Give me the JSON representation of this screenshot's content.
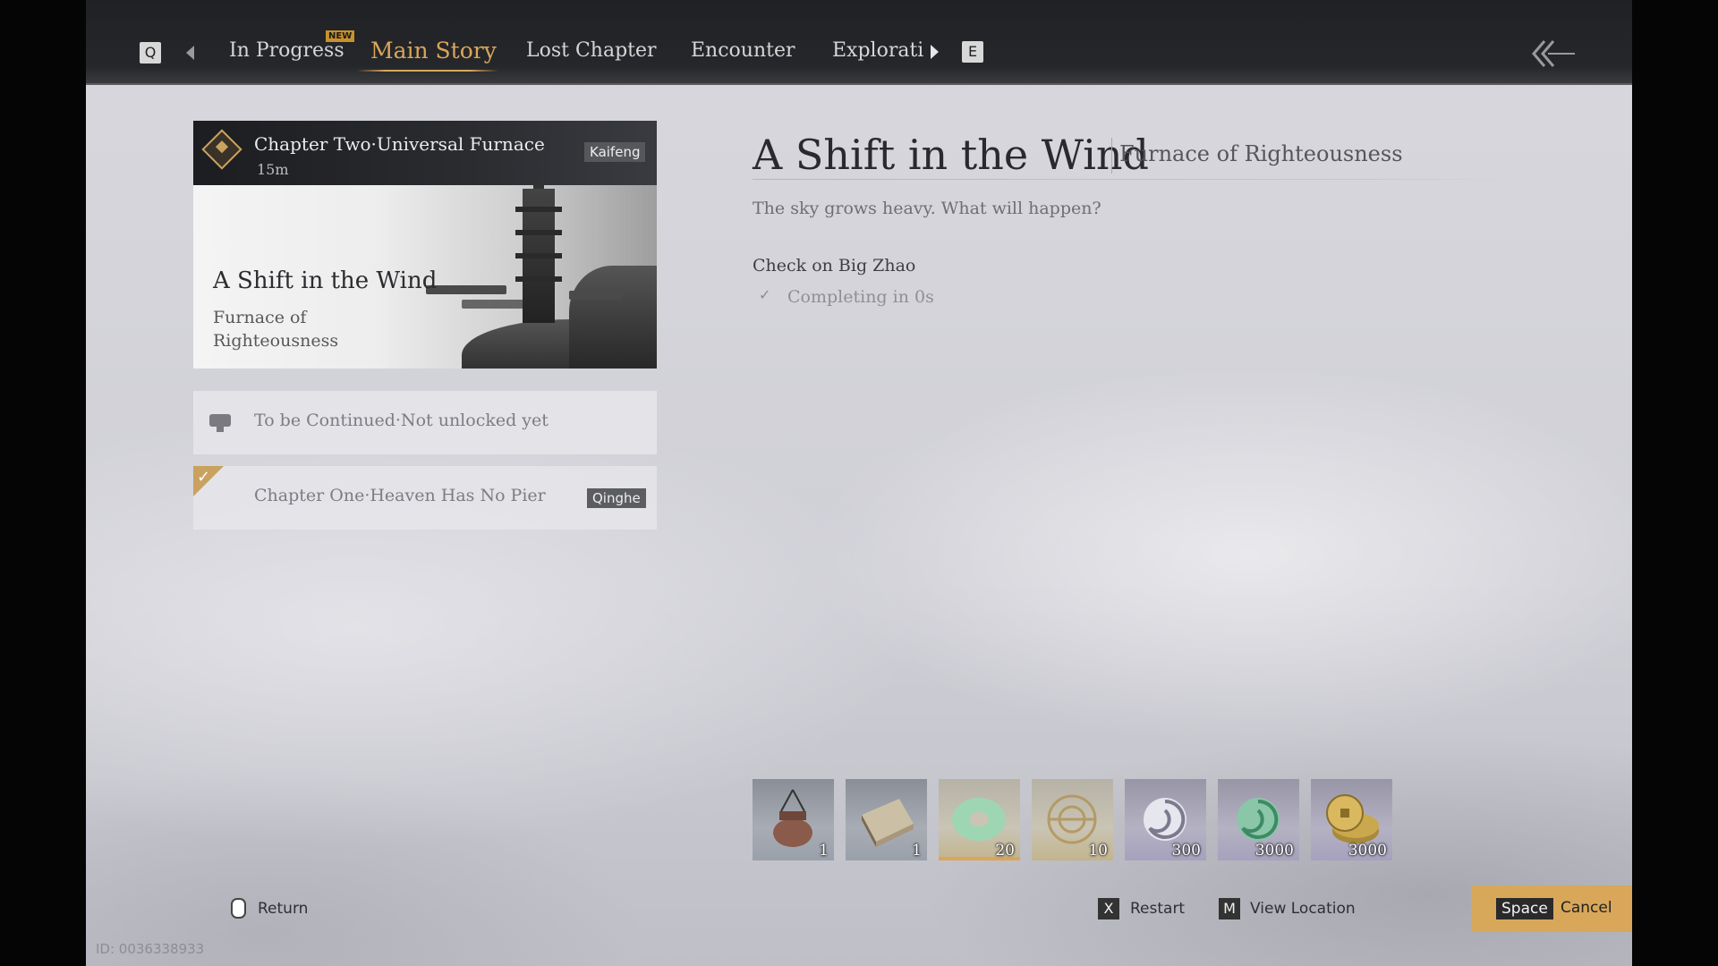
{
  "nav": {
    "left_key": "Q",
    "right_key": "E",
    "tabs": [
      {
        "label": "In Progress",
        "badge": "NEW"
      },
      {
        "label": "Main Story"
      },
      {
        "label": "Lost Chapter"
      },
      {
        "label": "Encounter"
      },
      {
        "label": "Explorati"
      }
    ],
    "active_tab": "Main Story"
  },
  "chapters": {
    "current": {
      "title": "Chapter Two·Universal Furnace",
      "time": "15m",
      "region": "Kaifeng",
      "quest_title": "A Shift in the Wind",
      "quest_subtitle": "Furnace of Righteousness"
    },
    "locked": {
      "label": "To be Continued·Not unlocked yet"
    },
    "completed": {
      "title": "Chapter One·Heaven Has No Pier",
      "region": "Qinghe"
    }
  },
  "quest": {
    "title": "A Shift in the Wind",
    "location": "Furnace of Righteousness",
    "description": "The sky grows heavy. What will happen?",
    "objective": "Check on Big Zhao",
    "objective_status": "Completing in 0s"
  },
  "rewards": [
    {
      "icon": "incense-burner-icon",
      "count": "1"
    },
    {
      "icon": "book-icon",
      "count": "1"
    },
    {
      "icon": "jade-disc-icon",
      "count": "20"
    },
    {
      "icon": "target-token-icon",
      "count": "10"
    },
    {
      "icon": "swirl-orb-icon",
      "count": "300"
    },
    {
      "icon": "green-swirl-icon",
      "count": "3000"
    },
    {
      "icon": "coins-icon",
      "count": "3000"
    }
  ],
  "bottom": {
    "return_label": "Return",
    "restart_key": "X",
    "restart_label": "Restart",
    "location_key": "M",
    "location_label": "View Location",
    "cancel_key": "Space",
    "cancel_label": "Cancel"
  },
  "player_id": "ID: 0036338933",
  "colors": {
    "accent_gold": "#d9a65a",
    "topbar": "#232528",
    "background": "#d4d4da"
  }
}
